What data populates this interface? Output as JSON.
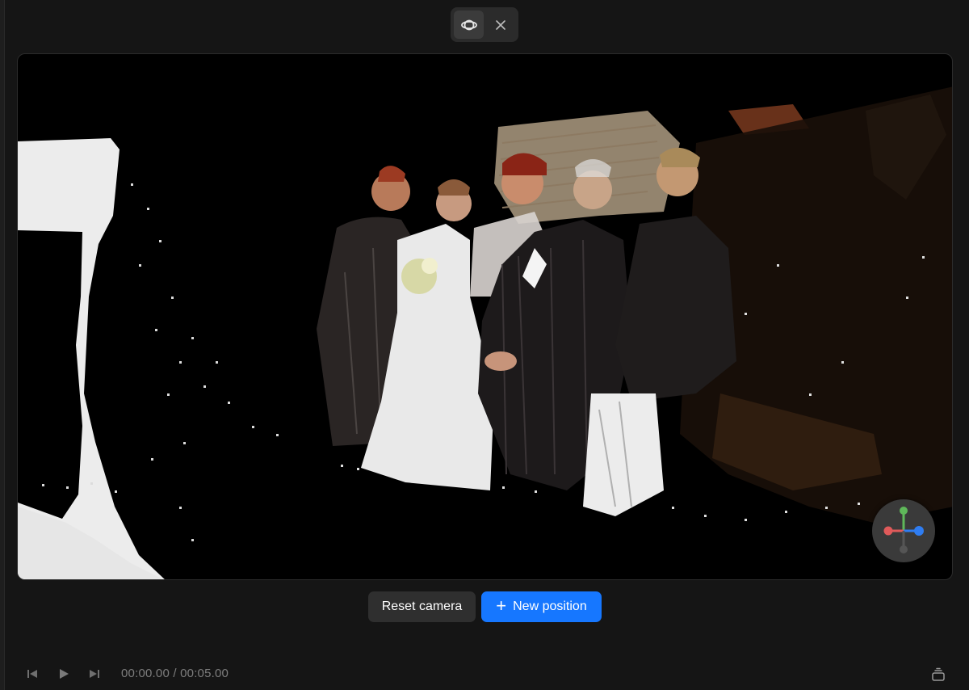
{
  "toolbar": {
    "orbit_icon": "orbit-icon",
    "close_icon": "close-icon"
  },
  "viewport": {
    "content": "3D point cloud of wedding group photo"
  },
  "gizmo": {
    "axes": [
      "x",
      "y",
      "z"
    ],
    "colors": {
      "x": "#e05a5a",
      "y": "#5fb85a",
      "z": "#2f7df2",
      "neg": "#555555"
    }
  },
  "actions": {
    "reset_label": "Reset camera",
    "new_position_label": "New position"
  },
  "playback": {
    "current_time": "00:00.00",
    "separator": " / ",
    "total_time": "00:05.00"
  },
  "colors": {
    "accent": "#1677ff",
    "background": "#151515",
    "viewport": "#000000"
  }
}
